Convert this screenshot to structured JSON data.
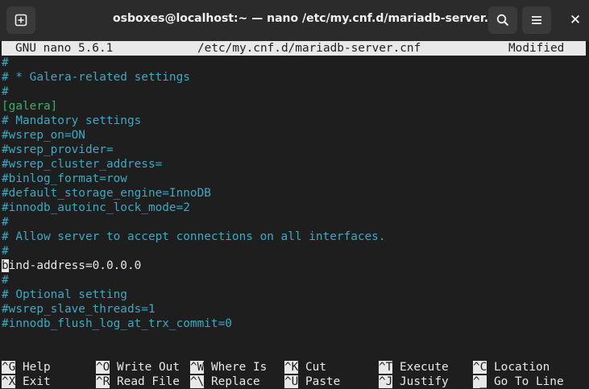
{
  "window": {
    "title": "osboxes@localhost:~ — nano /etc/my.cnf.d/mariadb-server.cnf",
    "close_glyph": "✕"
  },
  "nano": {
    "version": "GNU nano 5.6.1",
    "filename": "/etc/my.cnf.d/mariadb-server.cnf",
    "status": "Modified"
  },
  "lines": [
    {
      "text": "#",
      "kind": "comment"
    },
    {
      "text": "# * Galera-related settings",
      "kind": "comment"
    },
    {
      "text": "#",
      "kind": "comment"
    },
    {
      "text": "[galera]",
      "kind": "section"
    },
    {
      "text": "# Mandatory settings",
      "kind": "comment"
    },
    {
      "text": "#wsrep_on=ON",
      "kind": "comment"
    },
    {
      "text": "#wsrep_provider=",
      "kind": "comment"
    },
    {
      "text": "#wsrep_cluster_address=",
      "kind": "comment"
    },
    {
      "text": "#binlog_format=row",
      "kind": "comment"
    },
    {
      "text": "#default_storage_engine=InnoDB",
      "kind": "comment"
    },
    {
      "text": "#innodb_autoinc_lock_mode=2",
      "kind": "comment"
    },
    {
      "text": "#",
      "kind": "comment"
    },
    {
      "text": "# Allow server to accept connections on all interfaces.",
      "kind": "comment"
    },
    {
      "text": "#",
      "kind": "comment"
    },
    {
      "text": "bind-address=0.0.0.0",
      "kind": "plain",
      "cursor_char": "b",
      "rest": "ind-address=0.0.0.0"
    },
    {
      "text": "#",
      "kind": "comment"
    },
    {
      "text": "# Optional setting",
      "kind": "comment"
    },
    {
      "text": "#wsrep_slave_threads=1",
      "kind": "comment"
    },
    {
      "text": "#innodb_flush_log_at_trx_commit=0",
      "kind": "comment"
    }
  ],
  "shortcuts": {
    "row1": [
      {
        "key": "^G",
        "label": "Help"
      },
      {
        "key": "^O",
        "label": "Write Out"
      },
      {
        "key": "^W",
        "label": "Where Is"
      },
      {
        "key": "^K",
        "label": "Cut"
      },
      {
        "key": "^T",
        "label": "Execute"
      },
      {
        "key": "^C",
        "label": "Location"
      }
    ],
    "row2": [
      {
        "key": "^X",
        "label": "Exit"
      },
      {
        "key": "^R",
        "label": "Read File"
      },
      {
        "key": "^\\",
        "label": "Replace"
      },
      {
        "key": "^U",
        "label": "Paste"
      },
      {
        "key": "^J",
        "label": "Justify"
      },
      {
        "key": "^_",
        "label": "Go To Line"
      }
    ]
  },
  "icons": {
    "new_tab": "new-tab-icon",
    "search": "search-icon",
    "menu": "hamburger-menu-icon",
    "close": "close-icon"
  },
  "colors": {
    "comment": "#3fa8c4",
    "section": "#36b36a",
    "text": "#e8e8e8",
    "background": "#1e1e1e"
  }
}
